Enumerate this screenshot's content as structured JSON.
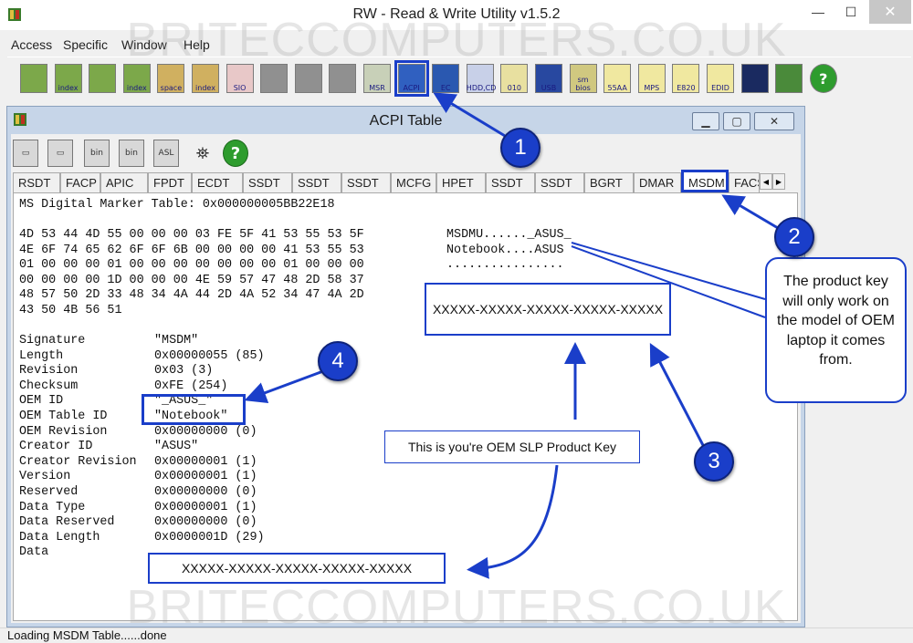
{
  "window": {
    "title": "RW - Read & Write Utility v1.5.2"
  },
  "menu": [
    "Access",
    "Specific",
    "Window",
    "Help"
  ],
  "toolbar": {
    "icons": [
      {
        "name": "pci-icon",
        "label": ""
      },
      {
        "name": "pci-index-icon",
        "label": "index"
      },
      {
        "name": "memory-icon",
        "label": ""
      },
      {
        "name": "memory-index-icon",
        "label": "index"
      },
      {
        "name": "io-space-icon",
        "label": "space"
      },
      {
        "name": "io-index-icon",
        "label": "index"
      },
      {
        "name": "sio-icon",
        "label": "SIO"
      },
      {
        "name": "disabled-icon-1",
        "label": ""
      },
      {
        "name": "disabled-icon-2",
        "label": ""
      },
      {
        "name": "disabled-icon-3",
        "label": ""
      },
      {
        "name": "msr-icon",
        "label": "MSR"
      },
      {
        "name": "acpi-icon",
        "label": "ACPI"
      },
      {
        "name": "ec-icon",
        "label": "EC"
      },
      {
        "name": "hdd-cd-icon",
        "label": "HDD,CD"
      },
      {
        "name": "spd-icon",
        "label": "010"
      },
      {
        "name": "usb-icon",
        "label": "USB"
      },
      {
        "name": "smbios-icon",
        "label": "sm bios"
      },
      {
        "name": "e55aa-icon",
        "label": "55AA"
      },
      {
        "name": "mps-icon",
        "label": "MPS"
      },
      {
        "name": "e820-icon",
        "label": "E820"
      },
      {
        "name": "edid-icon",
        "label": "EDID"
      },
      {
        "name": "console-icon",
        "label": ""
      },
      {
        "name": "battery-icon",
        "label": ""
      },
      {
        "name": "help-icon",
        "label": "?"
      }
    ]
  },
  "child": {
    "title": "ACPI Table",
    "tabs": [
      "RSDT",
      "FACP",
      "APIC",
      "FPDT",
      "ECDT",
      "SSDT",
      "SSDT",
      "SSDT",
      "MCFG",
      "HPET",
      "SSDT",
      "SSDT",
      "BGRT",
      "DMAR",
      "MSDM",
      "FACS"
    ],
    "active_tab": "MSDM",
    "table_header": "MS Digital Marker Table: 0x000000005BB22E18",
    "hex_lines": [
      "4D 53 44 4D 55 00 00 00 03 FE 5F 41 53 55 53 5F",
      "4E 6F 74 65 62 6F 6F 6B 00 00 00 00 41 53 55 53",
      "01 00 00 00 01 00 00 00 00 00 00 00 01 00 00 00",
      "00 00 00 00 1D 00 00 00 4E 59 57 47 48 2D 58 37",
      "48 57 50 2D 33 48 34 4A 44 2D 4A 52 34 47 4A 2D",
      "43 50 4B 56 51"
    ],
    "ascii_lines": [
      "MSDMU......_ASUS_",
      "Notebook....ASUS",
      "................"
    ],
    "fields": [
      {
        "name": "Signature",
        "value": "\"MSDM\""
      },
      {
        "name": "Length",
        "value": "0x00000055 (85)"
      },
      {
        "name": "Revision",
        "value": "0x03 (3)"
      },
      {
        "name": "Checksum",
        "value": "0xFE (254)"
      },
      {
        "name": "OEM ID",
        "value": "\"_ASUS_\""
      },
      {
        "name": "OEM Table ID",
        "value": "\"Notebook\""
      },
      {
        "name": "OEM Revision",
        "value": "0x00000000 (0)"
      },
      {
        "name": "Creator ID",
        "value": "\"ASUS\""
      },
      {
        "name": "Creator Revision",
        "value": "0x00000001 (1)"
      },
      {
        "name": "Version",
        "value": "0x00000001 (1)"
      },
      {
        "name": "Reserved",
        "value": "0x00000000 (0)"
      },
      {
        "name": "Data Type",
        "value": "0x00000001 (1)"
      },
      {
        "name": "Data Reserved",
        "value": "0x00000000 (0)"
      },
      {
        "name": "Data Length",
        "value": "0x0000001D (29)"
      },
      {
        "name": "Data",
        "value": ""
      }
    ]
  },
  "annotations": {
    "key_masked": "XXXXX-XXXXX-XXXXX-XXXXX-XXXXX",
    "data_key_masked": "XXXXX-XXXXX-XXXXX-XXXXX-XXXXX",
    "slp_label": "This is you're OEM SLP Product Key",
    "callout_text": "The product key will only work on the model of OEM laptop it comes from.",
    "badges": [
      "1",
      "2",
      "3",
      "4"
    ],
    "accent": "#1a3ec9"
  },
  "status": "Loading MSDM Table......done",
  "watermark": "BRITECCOMPUTERS.CO.UK"
}
